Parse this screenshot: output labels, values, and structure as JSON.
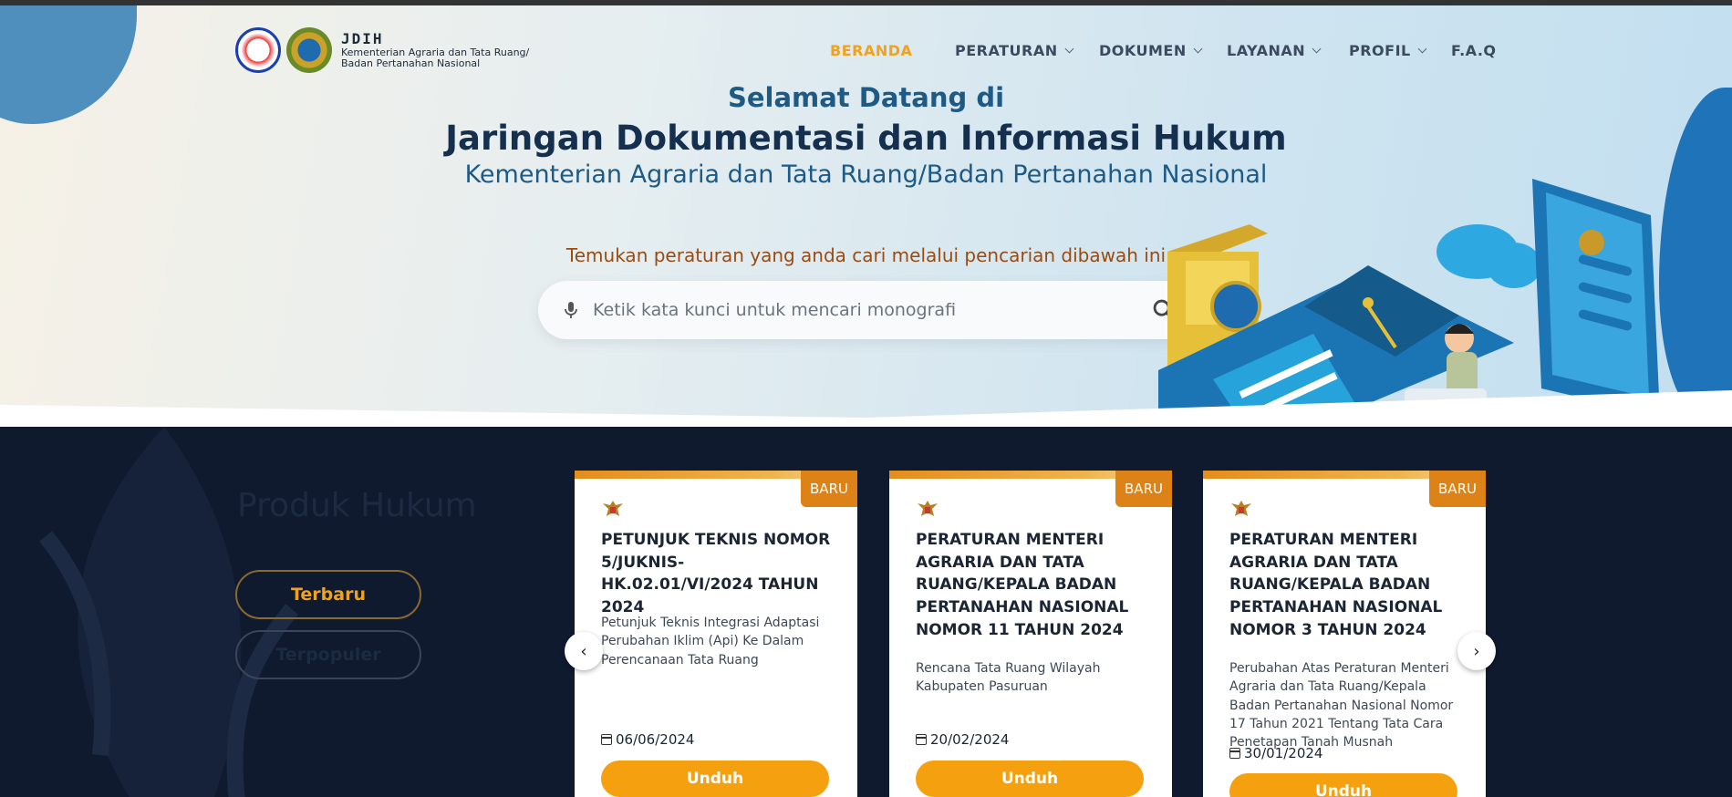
{
  "brand": {
    "title": "JDIH",
    "subtitle_line1": "Kementerian Agraria dan Tata Ruang/",
    "subtitle_line2": "Badan Pertanahan Nasional"
  },
  "nav": {
    "items": [
      {
        "label": "BERANDA",
        "active": true,
        "dropdown": false
      },
      {
        "label": "PERATURAN",
        "active": false,
        "dropdown": true
      },
      {
        "label": "DOKUMEN",
        "active": false,
        "dropdown": true
      },
      {
        "label": "LAYANAN",
        "active": false,
        "dropdown": true
      },
      {
        "label": "PROFIL",
        "active": false,
        "dropdown": true
      },
      {
        "label": "F.A.Q",
        "active": false,
        "dropdown": false
      }
    ]
  },
  "hero": {
    "line1": "Selamat Datang di",
    "line2": "Jaringan Dokumentasi dan Informasi Hukum",
    "line3": "Kementerian Agraria dan Tata Ruang/Badan Pertanahan Nasional",
    "prompt": "Temukan peraturan yang anda cari melalui pencarian dibawah ini"
  },
  "search": {
    "placeholder": "Ketik kata kunci untuk mencari monografi",
    "value": "",
    "mic_icon": "microphone-icon",
    "search_icon": "search-icon"
  },
  "products": {
    "section_title": "Produk Hukum",
    "filters": {
      "latest": "Terbaru",
      "popular": "Terpopuler"
    },
    "cards": [
      {
        "badge": "BARU",
        "title": "PETUNJUK TEKNIS NOMOR 5/JUKNIS-HK.02.01/VI/2024 TAHUN 2024",
        "description": "Petunjuk Teknis Integrasi Adaptasi Perubahan Iklim (Api) Ke Dalam Perencanaan Tata Ruang",
        "date": "06/06/2024",
        "button": "Unduh"
      },
      {
        "badge": "BARU",
        "title": "PERATURAN MENTERI AGRARIA DAN TATA RUANG/KEPALA BADAN PERTANAHAN NASIONAL NOMOR 11 TAHUN 2024",
        "description": "Rencana Tata Ruang Wilayah Kabupaten Pasuruan",
        "date": "20/02/2024",
        "button": "Unduh"
      },
      {
        "badge": "BARU",
        "title": "PERATURAN MENTERI AGRARIA DAN TATA RUANG/KEPALA BADAN PERTANAHAN NASIONAL NOMOR 3 TAHUN 2024",
        "description": "Perubahan Atas Peraturan Menteri Agraria dan Tata Ruang/Kepala Badan Pertanahan Nasional Nomor 17 Tahun 2021 Tentang Tata Cara Penetapan Tanah Musnah",
        "date": "30/01/2024",
        "button": "Unduh"
      }
    ],
    "prev_icon": "chevron-left-icon",
    "next_icon": "chevron-right-icon",
    "prev_glyph": "‹",
    "next_glyph": "›"
  },
  "colors": {
    "accent": "#f0a21c",
    "badge": "#dd8216",
    "button": "#f5a00f",
    "dark_bg": "#0f1a2e",
    "heading": "#15304f"
  }
}
